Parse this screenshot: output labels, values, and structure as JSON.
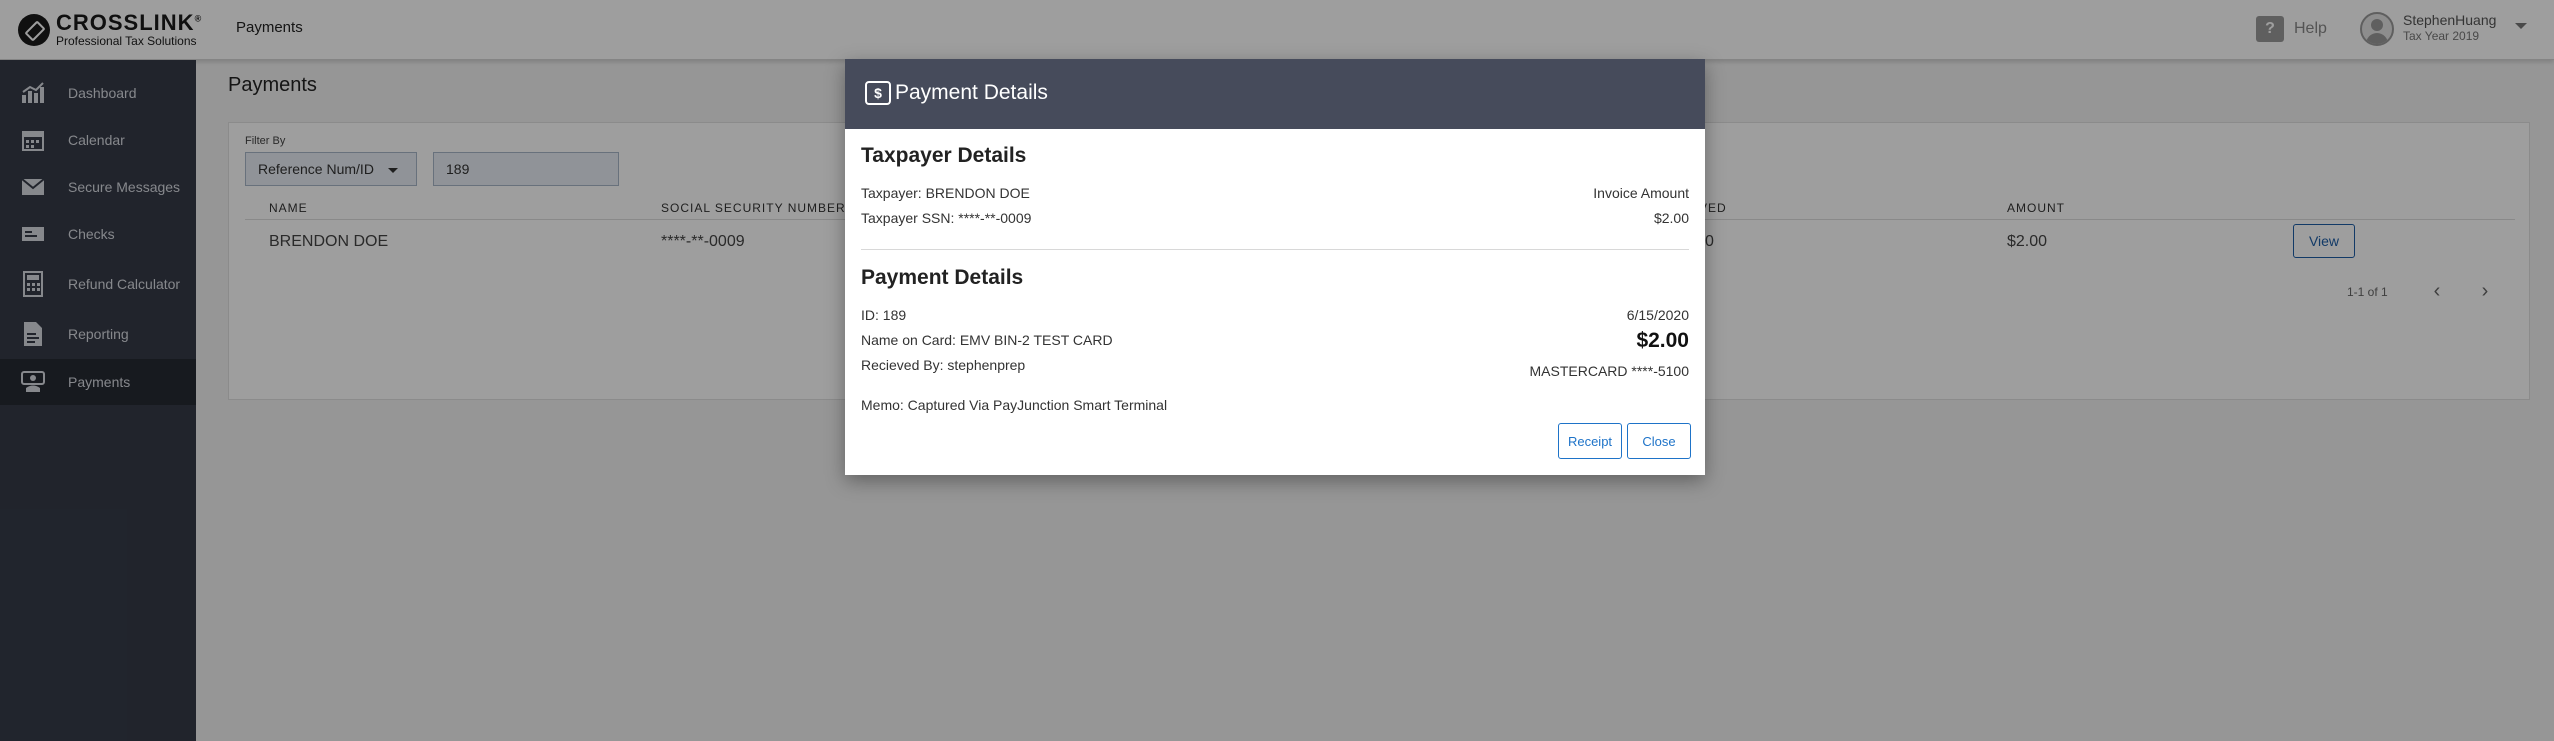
{
  "brand": {
    "name": "CROSSLINK",
    "tagline": "Professional Tax Solutions",
    "trademark": "®"
  },
  "topbar": {
    "active_tab": "Payments",
    "help_label": "Help",
    "user_name": "StephenHuang",
    "tax_year": "Tax Year 2019"
  },
  "sidebar": {
    "items": [
      {
        "label": "Dashboard",
        "icon": "dashboard-icon",
        "active": false
      },
      {
        "label": "Calendar",
        "icon": "calendar-icon",
        "active": false
      },
      {
        "label": "Secure Messages",
        "icon": "envelope-icon",
        "active": false
      },
      {
        "label": "Checks",
        "icon": "checks-icon",
        "active": false
      },
      {
        "label": "Refund Calculator",
        "icon": "calculator-icon",
        "active": false
      },
      {
        "label": "Reporting",
        "icon": "reporting-icon",
        "active": false
      },
      {
        "label": "Payments",
        "icon": "payments-icon",
        "active": true
      }
    ]
  },
  "page": {
    "title": "Payments",
    "filter": {
      "label": "Filter By",
      "selected": "Reference Num/ID",
      "value": "189"
    },
    "table": {
      "columns": [
        "NAME",
        "SOCIAL SECURITY NUMBER",
        "VED",
        "AMOUNT"
      ],
      "rows": [
        {
          "name": "BRENDON DOE",
          "ssn": "****-**-0009",
          "received": "0",
          "amount": "$2.00",
          "action": "View"
        }
      ]
    },
    "pager": {
      "range": "1-1 of 1"
    }
  },
  "modal": {
    "title": "Payment Details",
    "taxpayer_section": {
      "heading": "Taxpayer Details",
      "taxpayer": "Taxpayer: BRENDON DOE",
      "ssn": "Taxpayer SSN: ****-**-0009",
      "invoice_label": "Invoice Amount",
      "invoice_amount": "$2.00"
    },
    "payment_section": {
      "heading": "Payment Details",
      "id": "ID: 189",
      "name_on_card": "Name on Card: EMV BIN-2 TEST CARD",
      "received_by": "Recieved By: stephenprep",
      "memo": "Memo: Captured Via PayJunction Smart Terminal",
      "date": "6/15/2020",
      "amount": "$2.00",
      "card": "MASTERCARD ****-5100"
    },
    "buttons": {
      "receipt": "Receipt",
      "close": "Close"
    }
  },
  "colors": {
    "sidebar_bg": "#363b48",
    "sidebar_active": "#262a33",
    "modal_header": "#464b5b",
    "accent": "#1e73c8"
  }
}
